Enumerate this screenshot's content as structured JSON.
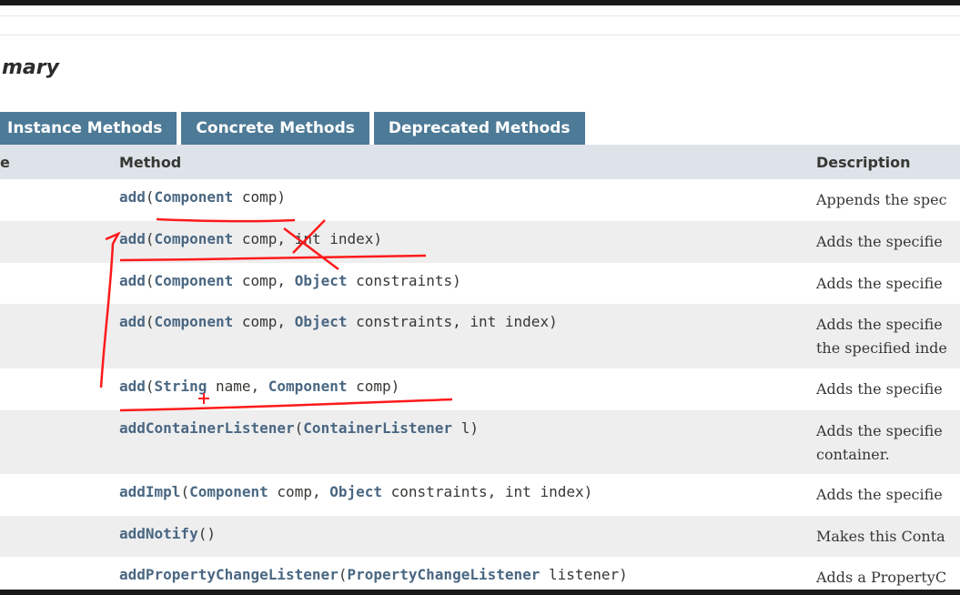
{
  "heading": "mary",
  "tabs": [
    "Instance Methods",
    "Concrete Methods",
    "Deprecated Methods"
  ],
  "table_header": {
    "col1": "e",
    "method": "Method",
    "description": "Description"
  },
  "rows": [
    {
      "name": "add",
      "params": [
        {
          "type": "Component",
          "name": "comp"
        }
      ],
      "desc": [
        "Appends the spec"
      ]
    },
    {
      "name": "add",
      "params": [
        {
          "type": "Component",
          "name": "comp"
        },
        {
          "type": "int",
          "name": "index"
        }
      ],
      "desc": [
        "Adds the specifie"
      ]
    },
    {
      "name": "add",
      "params": [
        {
          "type": "Component",
          "name": "comp"
        },
        {
          "type": "Object",
          "name": "constraints"
        }
      ],
      "desc": [
        "Adds the specifie"
      ]
    },
    {
      "name": "add",
      "params": [
        {
          "type": "Component",
          "name": "comp"
        },
        {
          "type": "Object",
          "name": "constraints"
        },
        {
          "type": "int",
          "name": "index"
        }
      ],
      "desc": [
        "Adds the specifie",
        "the specified inde"
      ]
    },
    {
      "name": "add",
      "params": [
        {
          "type": "String",
          "name": "name"
        },
        {
          "type": "Component",
          "name": "comp"
        }
      ],
      "desc": [
        "Adds the specifie"
      ]
    },
    {
      "name": "addContainerListener",
      "params": [
        {
          "type": "ContainerListener",
          "name": "l"
        }
      ],
      "desc": [
        "Adds the specifie",
        "container."
      ]
    },
    {
      "name": "addImpl",
      "params": [
        {
          "type": "Component",
          "name": "comp"
        },
        {
          "type": "Object",
          "name": "constraints"
        },
        {
          "type": "int",
          "name": "index"
        }
      ],
      "desc": [
        "Adds the specifie"
      ]
    },
    {
      "name": "addNotify",
      "params": [],
      "desc": [
        "Makes this Conta"
      ]
    },
    {
      "name": "addPropertyChangeListener",
      "params": [
        {
          "type": "PropertyChangeListener",
          "name": "listener"
        }
      ],
      "desc": [
        "Adds a PropertyC"
      ]
    }
  ],
  "colors": {
    "tab_bg": "#4d7a97",
    "header_bg": "#dee3e9",
    "alt_row_bg": "#eeeeef",
    "link": "#4a6782",
    "annotation": "#ff1a1a"
  }
}
